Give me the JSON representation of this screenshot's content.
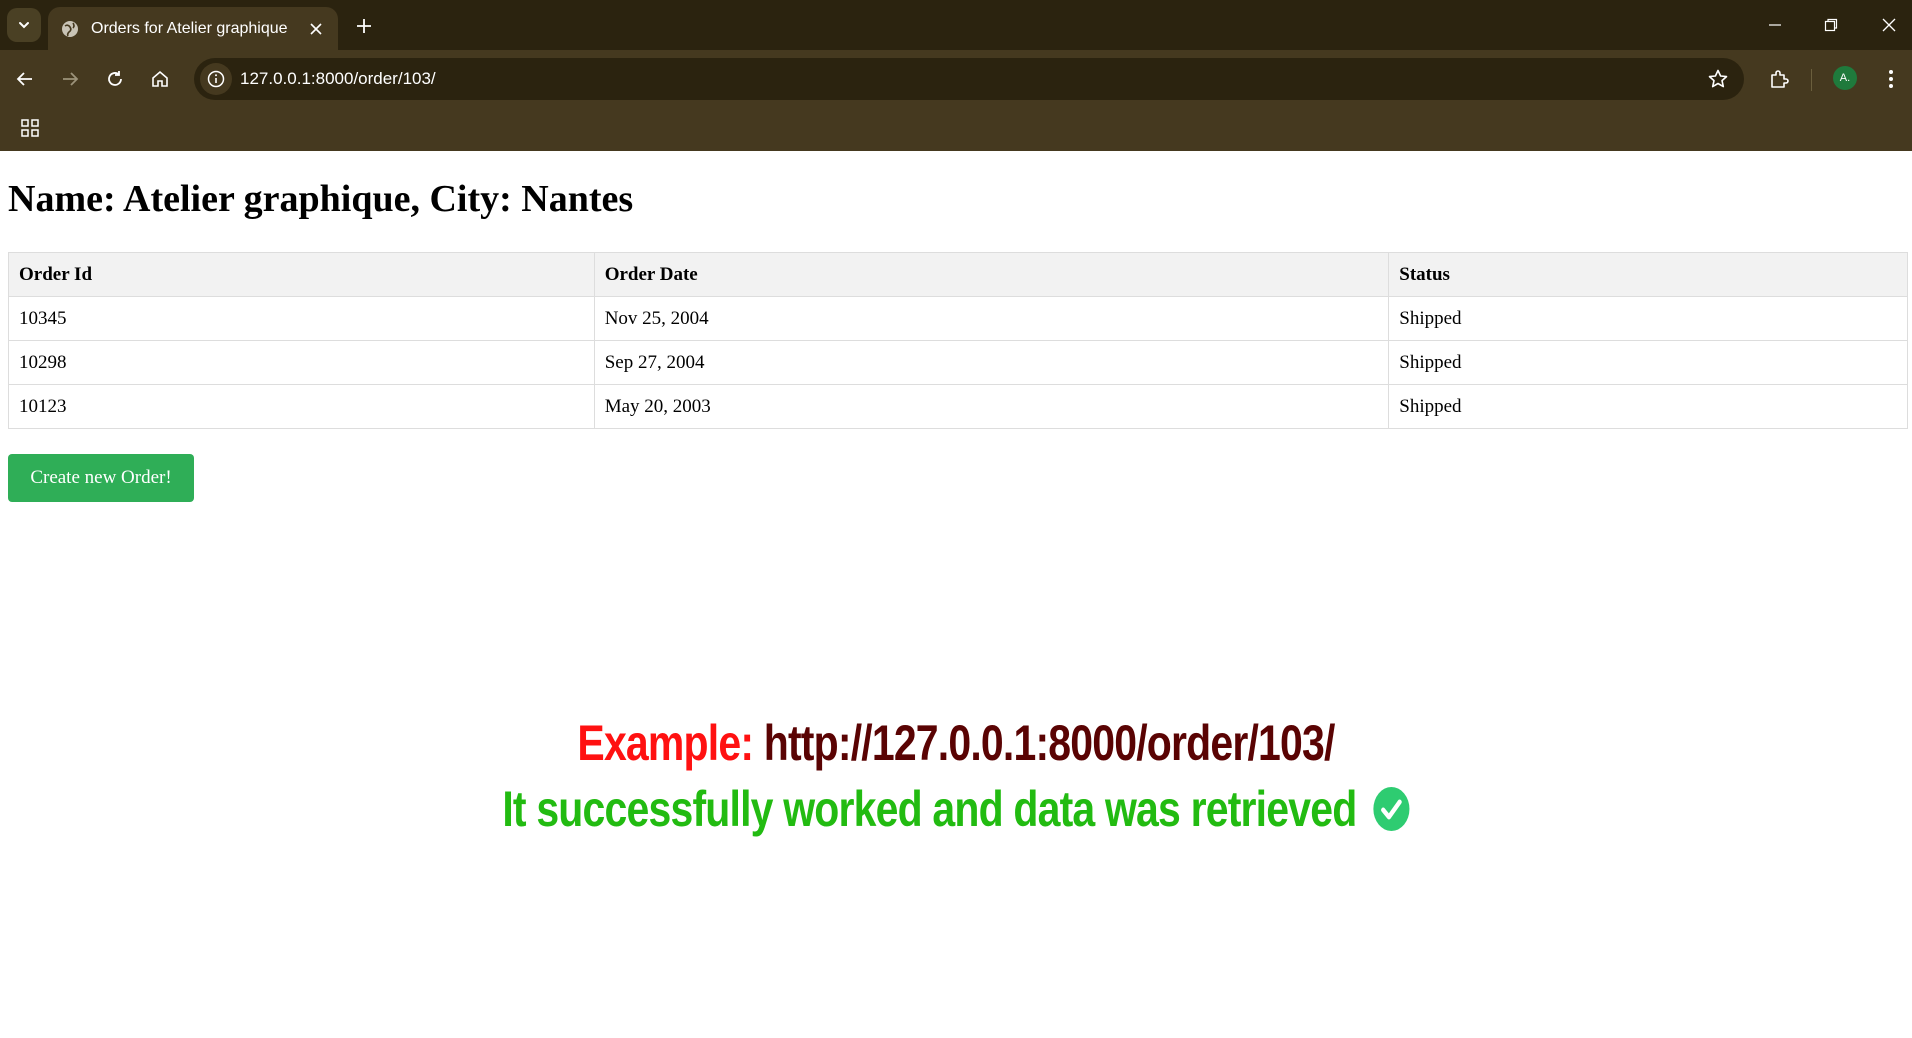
{
  "browser": {
    "tab_title": "Orders for Atelier graphique",
    "url": "127.0.0.1:8000/order/103/",
    "profile_initial": "A."
  },
  "page": {
    "title": "Name: Atelier graphique, City: Nantes",
    "table": {
      "headers": [
        "Order Id",
        "Order Date",
        "Status"
      ],
      "rows": [
        [
          "10345",
          "Nov 25, 2004",
          "Shipped"
        ],
        [
          "10298",
          "Sep 27, 2004",
          "Shipped"
        ],
        [
          "10123",
          "May 20, 2003",
          "Shipped"
        ]
      ]
    },
    "create_button_label": "Create new Order!"
  },
  "caption": {
    "example_label": "Example:",
    "example_url": "http://127.0.0.1:8000/order/103/",
    "success_text": "It successfully worked and data was retrieved",
    "success_icon": "check-circle-icon"
  },
  "colors": {
    "chrome_dark": "#2b230f",
    "chrome_toolbar": "#45391f",
    "button_green": "#2fae57",
    "example_red": "#ff1111",
    "url_darkred": "#5a0303",
    "success_green": "#22bb11"
  }
}
